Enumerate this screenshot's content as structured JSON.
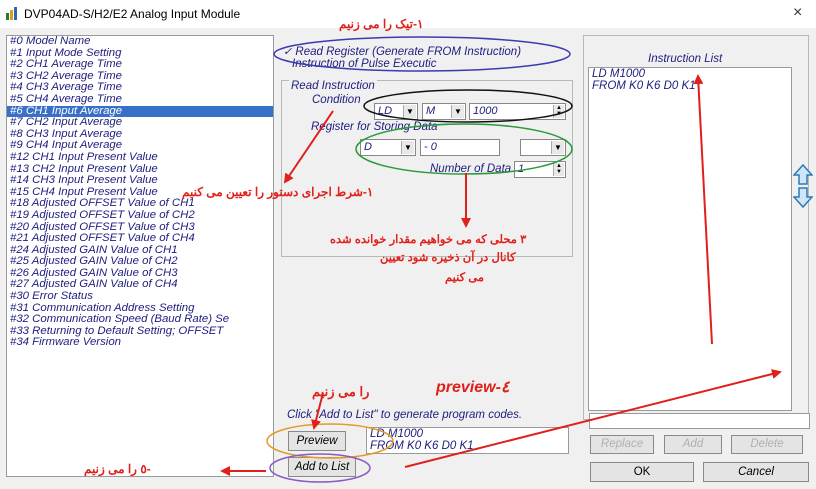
{
  "window": {
    "title": "DVP04AD-S/H2/E2 Analog Input Module"
  },
  "register_list": [
    "#0  Model Name",
    "#1  Input Mode Setting",
    "#2  CH1  Average Time",
    "#3  CH2  Average Time",
    "#4  CH3  Average Time",
    "#5  CH4  Average Time",
    "#6  CH1  Input Average",
    "#7  CH2  Input Average",
    "#8  CH3  Input Average",
    "#9  CH4  Input Average",
    "#12 CH1 Input Present Value",
    "#13 CH2 Input Present Value",
    "#14 CH3 Input Present Value",
    "#15 CH4 Input Present Value",
    "#18 Adjusted OFFSET Value of CH1",
    "#19 Adjusted OFFSET Value of CH2",
    "#20 Adjusted OFFSET Value of CH3",
    "#21 Adjusted OFFSET Value of CH4",
    "#24 Adjusted GAIN Value of CH1",
    "#25 Adjusted GAIN Value of CH2",
    "#26 Adjusted GAIN Value of CH3",
    "#27 Adjusted GAIN Value of CH4",
    "#30 Error Status",
    "#31 Communication Address Setting",
    "#32 Communication Speed (Baud Rate) Se",
    "#33 Returning to Default Setting; OFFSET",
    "#34 Firmware Version"
  ],
  "selected_index": 6,
  "mode": {
    "read_register": "Read Register (Generate FROM Instruction)",
    "pulse_instruction": "Instruction of Pulse Executic"
  },
  "read_instruction": {
    "group_label": "Read Instruction",
    "condition_label": "Condition",
    "cond_instr": "LD",
    "cond_device": "M",
    "cond_value": "1000",
    "register_label": "Register for Storing Data",
    "reg_device": "D",
    "reg_sep": "-",
    "reg_value": "0",
    "reg_extra": "",
    "num_data_label": "Number of Data",
    "num_data_value": "1"
  },
  "generate": {
    "hint": "Click \"Add to List\" to generate program codes.",
    "preview_label": "Preview",
    "add_label": "Add to List",
    "preview_lines": [
      "LD M1000",
      "FROM K0 K6 D0 K1"
    ]
  },
  "instruction_list": {
    "header": "Instruction List",
    "lines": [
      "LD M1000",
      "FROM K0 K6 D0 K1"
    ]
  },
  "list_buttons": {
    "replace": "Replace",
    "add": "Add",
    "delete": "Delete"
  },
  "dialog_buttons": {
    "ok": "OK",
    "cancel": "Cancel"
  },
  "annotations": {
    "a1": "۱-تیک را می زنیم",
    "a2": "۱-شرط اجرای دستور را تعیین می کنیم",
    "a3_l1": "۳  محلی که می خواهیم مقدار خوانده شده",
    "a3_l2": "کانال در آن ذخیره شود تعیین",
    "a3_l3": "می کنیم",
    "a4_fa": "را می زنیم",
    "a4_en": "preview-٤",
    "a5": "-٥  را می زنیم"
  },
  "colors": {
    "selection": "#3870c8",
    "annotation": "#e0201a",
    "text": "#1d1d7f"
  }
}
